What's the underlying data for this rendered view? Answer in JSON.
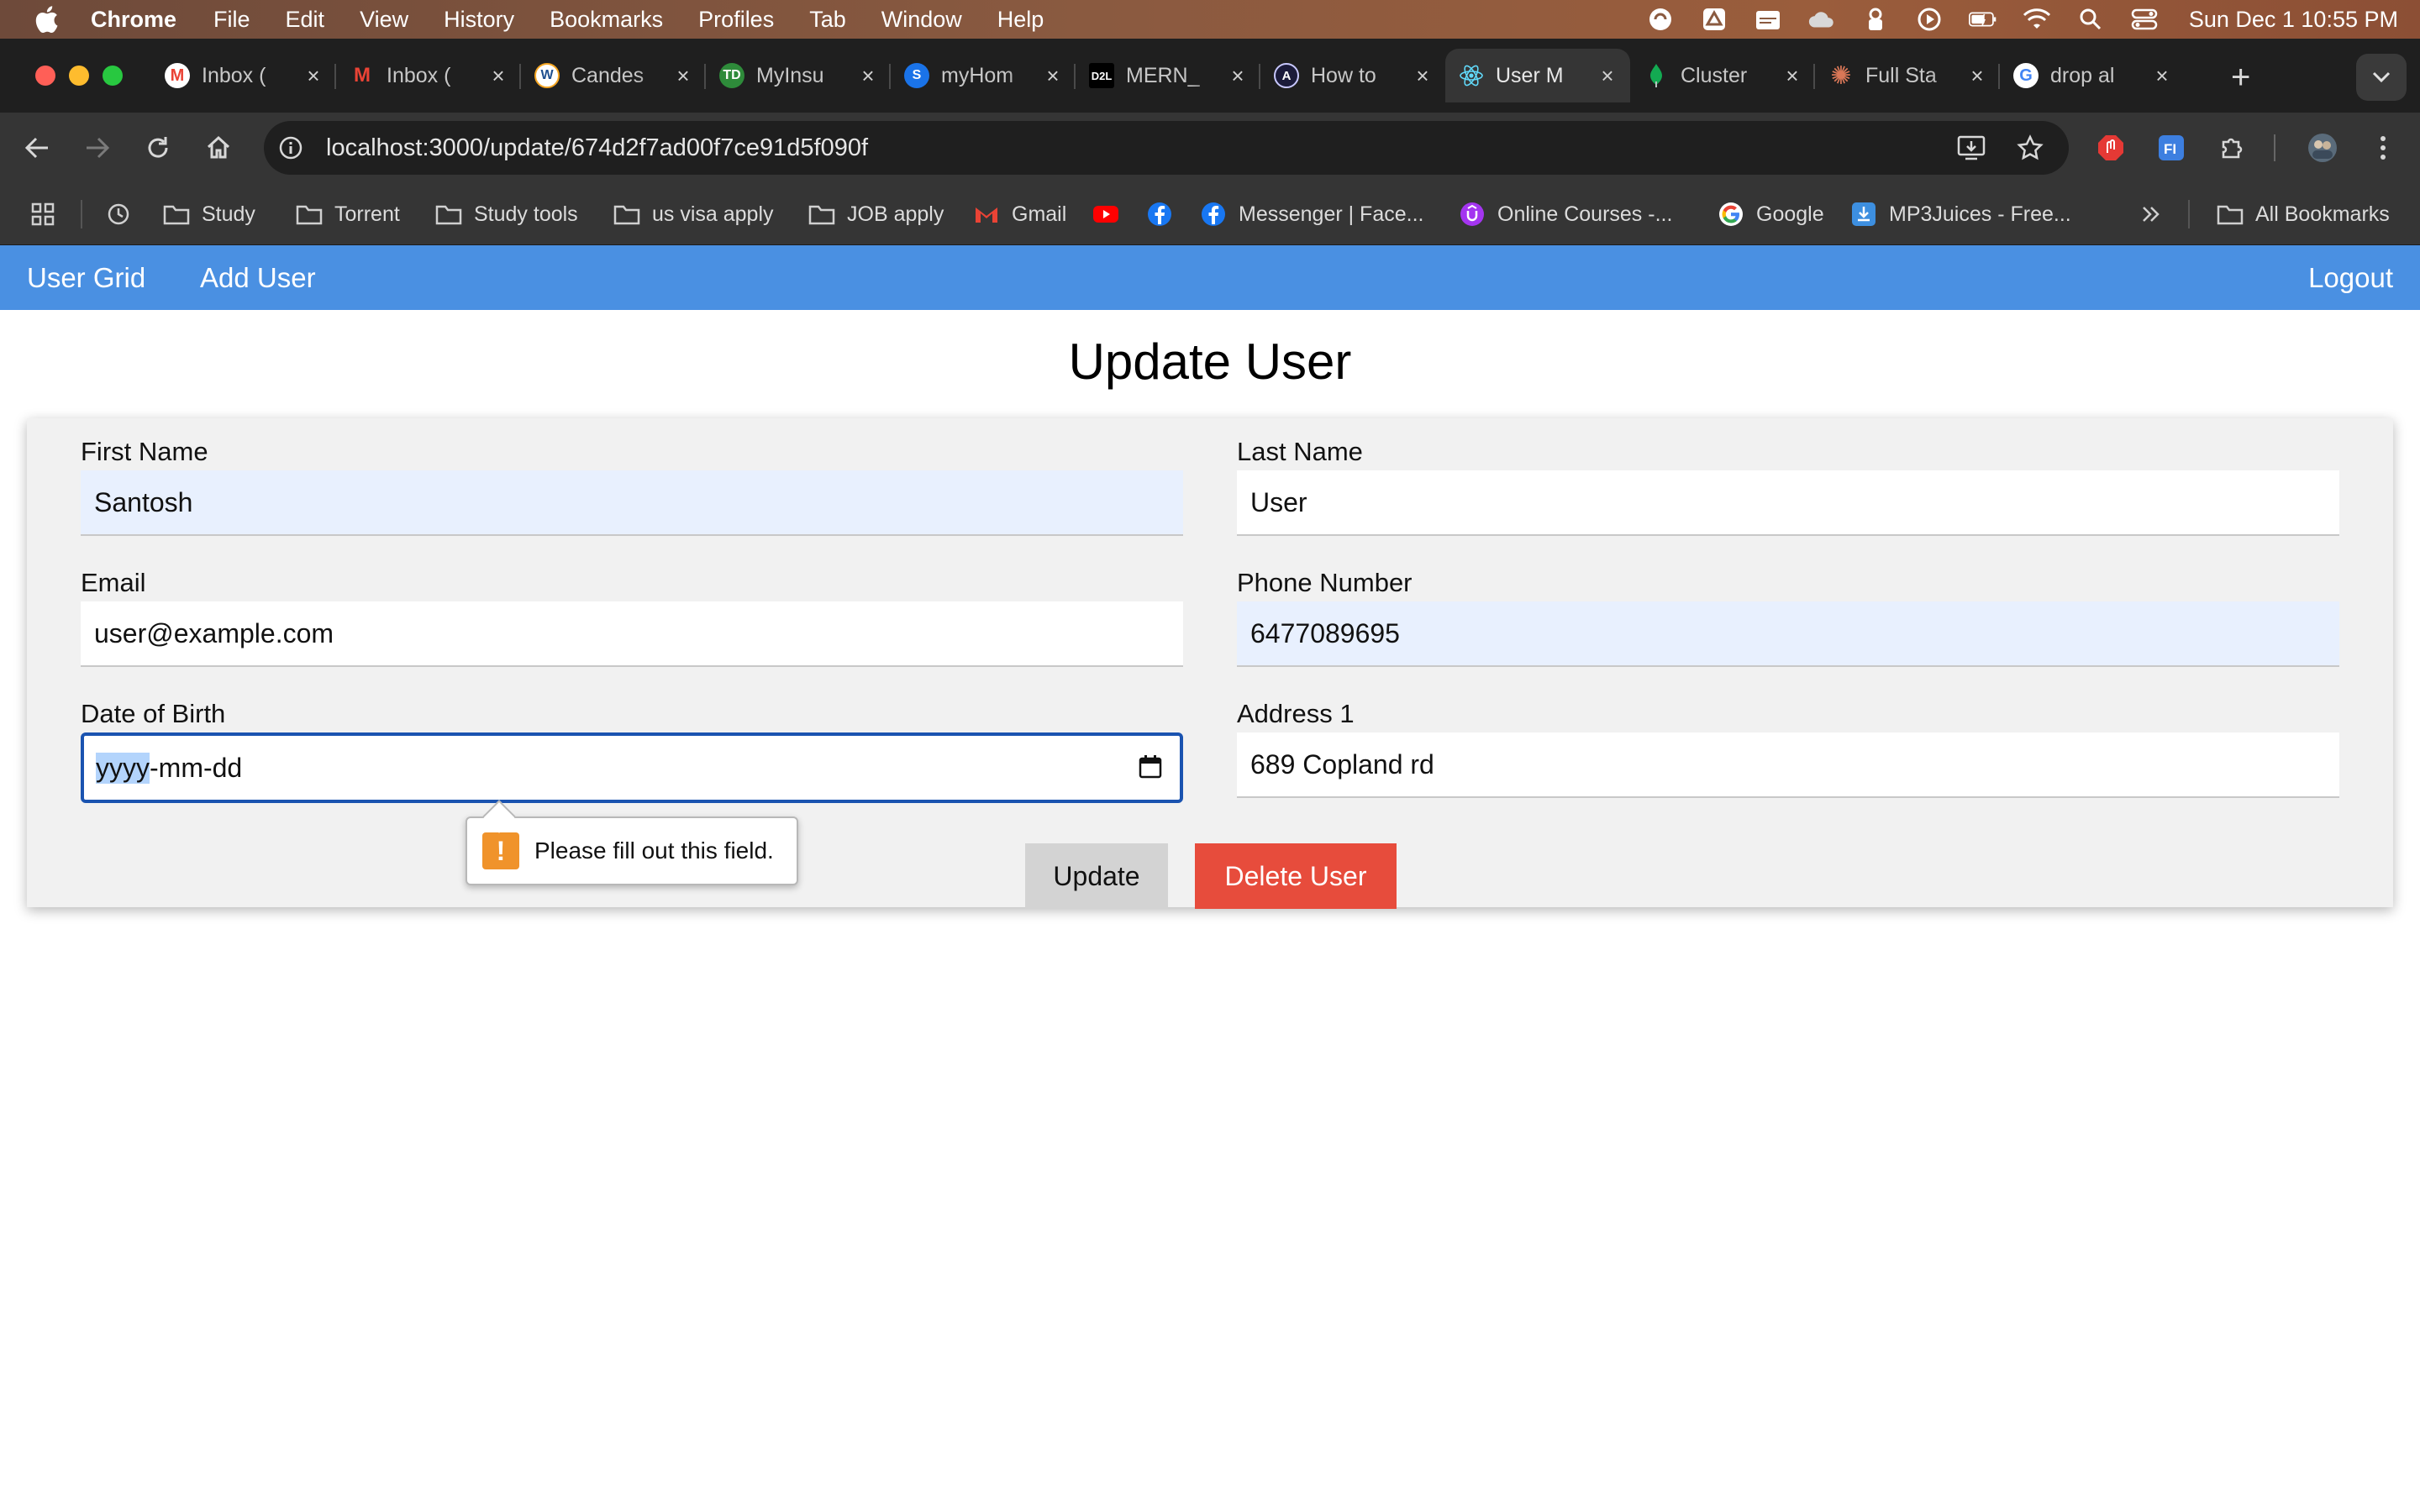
{
  "menubar": {
    "app_name": "Chrome",
    "items": [
      "File",
      "Edit",
      "View",
      "History",
      "Bookmarks",
      "Profiles",
      "Tab",
      "Window",
      "Help"
    ],
    "clock": "Sun Dec 1  10:55 PM"
  },
  "tabs": [
    {
      "title": "Inbox (",
      "icon": "gmail-icon",
      "color": "#ea4335"
    },
    {
      "title": "Inbox (",
      "icon": "gmail-icon",
      "color": "#ea4335"
    },
    {
      "title": "Candes",
      "icon": "workday-icon",
      "color": "#f5a623"
    },
    {
      "title": "MyInsu",
      "icon": "td-icon",
      "color": "#2e8b3a"
    },
    {
      "title": "myHom",
      "icon": "myhome-icon",
      "color": "#1a73e8"
    },
    {
      "title": "MERN_",
      "icon": "d2l-icon",
      "color": "#000000"
    },
    {
      "title": "How to",
      "icon": "angular-icon",
      "color": "#1b1b3a"
    },
    {
      "title": "User M",
      "icon": "react-icon",
      "color": "#61dafb"
    },
    {
      "title": "Cluster",
      "icon": "mongodb-icon",
      "color": "#13aa52"
    },
    {
      "title": "Full Sta",
      "icon": "claude-icon",
      "color": "#d97757"
    },
    {
      "title": "drop al",
      "icon": "google-icon",
      "color": "#4285f4"
    }
  ],
  "active_tab_index": 7,
  "address_bar": {
    "url": "localhost:3000/update/674d2f7ad00f7ce91d5f090f"
  },
  "bookmarks": [
    {
      "label": "Study",
      "icon": "folder-icon"
    },
    {
      "label": "Torrent",
      "icon": "folder-icon"
    },
    {
      "label": "Study tools",
      "icon": "folder-icon"
    },
    {
      "label": "us visa apply",
      "icon": "folder-icon"
    },
    {
      "label": "JOB apply",
      "icon": "folder-icon"
    },
    {
      "label": "Gmail",
      "icon": "gmail-icon"
    },
    {
      "label": "Messenger | Face...",
      "icon": "facebook-icon"
    },
    {
      "label": "Online Courses -...",
      "icon": "udemy-icon"
    },
    {
      "label": "Google",
      "icon": "google-icon"
    },
    {
      "label": "MP3Juices - Free...",
      "icon": "download-icon"
    },
    {
      "label": "All Bookmarks",
      "icon": "folder-icon"
    }
  ],
  "appnav": {
    "user_grid": "User Grid",
    "add_user": "Add User",
    "logout": "Logout"
  },
  "form": {
    "title": "Update User",
    "first_name": {
      "label": "First Name",
      "value": "Santosh"
    },
    "last_name": {
      "label": "Last Name",
      "value": "User"
    },
    "email": {
      "label": "Email",
      "value": "user@example.com"
    },
    "phone": {
      "label": "Phone Number",
      "value": "6477089695"
    },
    "dob": {
      "label": "Date of Birth",
      "seg_year": "yyyy",
      "seg_rest": "-mm-dd"
    },
    "address1": {
      "label": "Address 1",
      "value": "689 Copland rd"
    },
    "update_button": "Update",
    "delete_button": "Delete User"
  },
  "validation": {
    "message": "Please fill out this field."
  },
  "colors": {
    "nav_blue": "#4a90e2",
    "delete_red": "#e74c3c",
    "focus_blue": "#1a53b0",
    "autofill_bg": "#e8f0fe"
  }
}
